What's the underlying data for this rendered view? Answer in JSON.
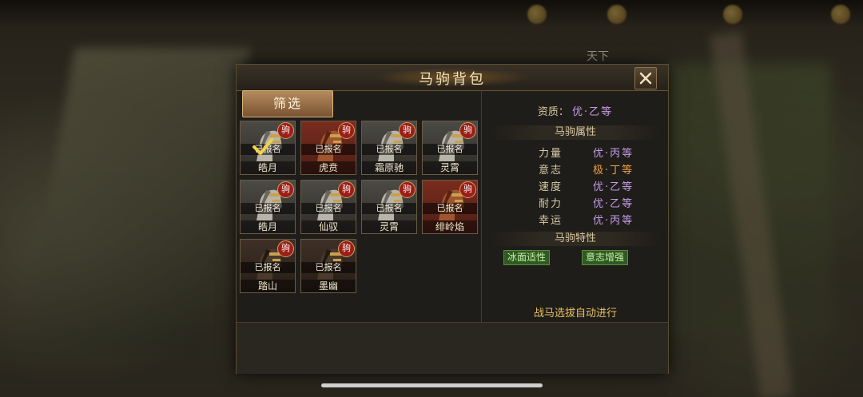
{
  "background": {
    "world_label": "天下"
  },
  "dialog": {
    "title": "马驹背包",
    "filter_label": "筛选",
    "horses": [
      {
        "name": "皓月",
        "badge": "驹",
        "status": "已报名",
        "color": "grey",
        "selected": true
      },
      {
        "name": "虎贲",
        "badge": "驹",
        "status": "已报名",
        "color": "red",
        "selected": false
      },
      {
        "name": "霜原驰",
        "badge": "驹",
        "status": "已报名",
        "color": "grey",
        "selected": false
      },
      {
        "name": "灵霄",
        "badge": "驹",
        "status": "已报名",
        "color": "grey",
        "selected": false
      },
      {
        "name": "皓月",
        "badge": "驹",
        "status": "已报名",
        "color": "grey",
        "selected": false
      },
      {
        "name": "仙驭",
        "badge": "驹",
        "status": "已报名",
        "color": "grey",
        "selected": false
      },
      {
        "name": "灵霄",
        "badge": "驹",
        "status": "已报名",
        "color": "grey",
        "selected": false
      },
      {
        "name": "绯岭焰",
        "badge": "驹",
        "status": "已报名",
        "color": "red",
        "selected": false
      },
      {
        "name": "踏山",
        "badge": "驹",
        "status": "已报名",
        "color": "dark",
        "selected": false
      },
      {
        "name": "墨幽",
        "badge": "驹",
        "status": "已报名",
        "color": "dark",
        "selected": false
      }
    ],
    "info": {
      "quality_label": "资质：",
      "quality_value": "优·乙等",
      "attributes_title": "马驹属性",
      "attributes": [
        {
          "key": "力量",
          "value": "优·丙等",
          "tone": "purple"
        },
        {
          "key": "意志",
          "value": "极·丁等",
          "tone": "orange"
        },
        {
          "key": "速度",
          "value": "优·乙等",
          "tone": "purple"
        },
        {
          "key": "耐力",
          "value": "优·乙等",
          "tone": "purple"
        },
        {
          "key": "幸运",
          "value": "优·丙等",
          "tone": "purple"
        }
      ],
      "traits_title": "马驹特性",
      "traits": [
        "冰面适性",
        "意志增强"
      ],
      "auto_note": "战马选拔自动进行"
    }
  },
  "colors": {
    "quality_purple": "#c79ce8",
    "attribute_orange": "#f0a040",
    "trait_green": "#2f5a24",
    "note_gold": "#e8c060"
  }
}
